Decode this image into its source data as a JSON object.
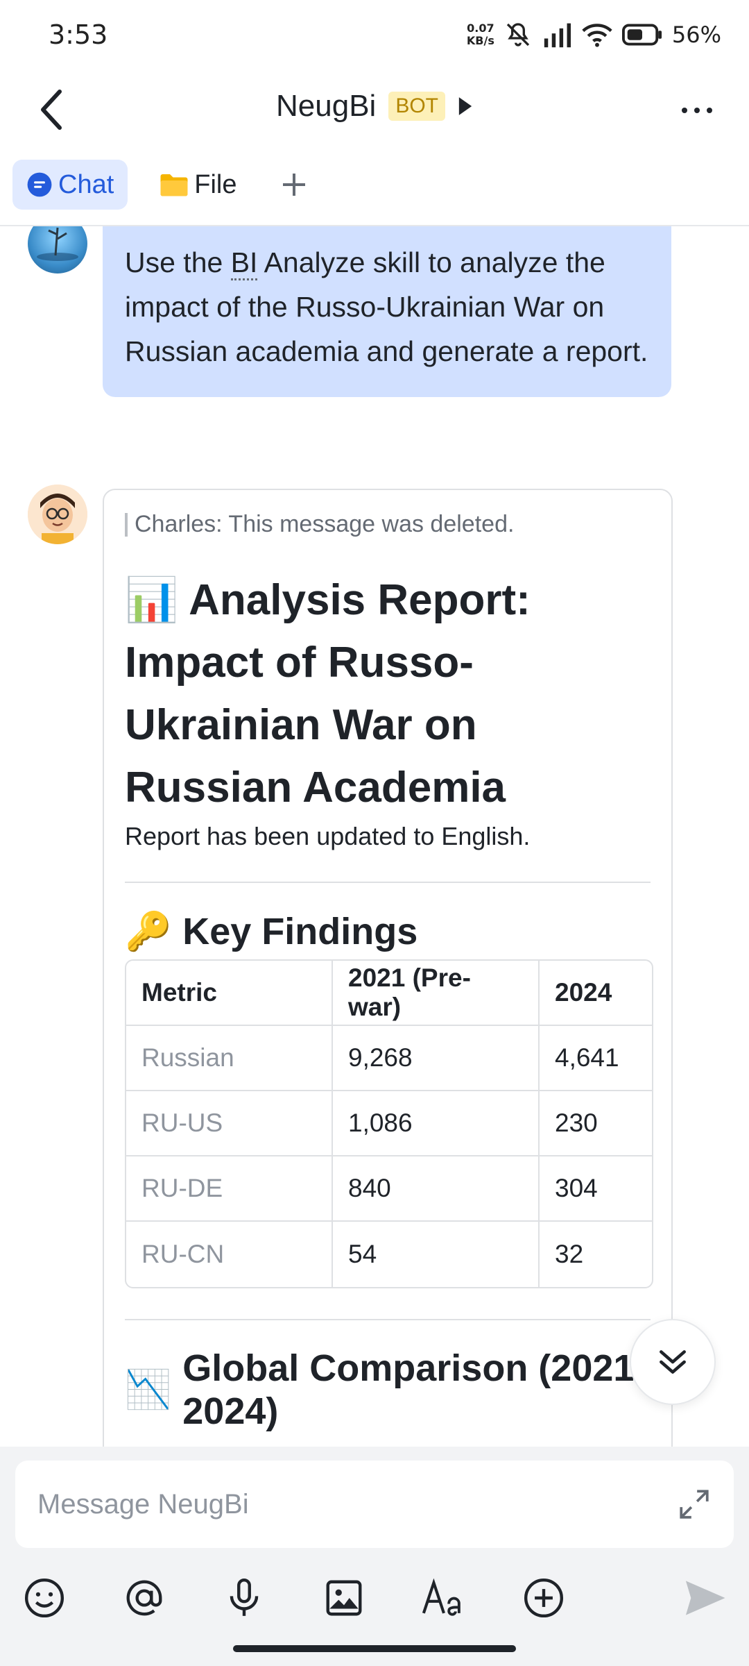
{
  "status_bar": {
    "time": "3:53",
    "net_speed_value": "0.07",
    "net_speed_unit": "KB/s",
    "battery": "56%"
  },
  "header": {
    "title": "NeugBi",
    "badge": "BOT"
  },
  "tabs": [
    {
      "label": "Chat",
      "icon": "chat-bubble-icon",
      "active": true
    },
    {
      "label": "File",
      "icon": "folder-icon",
      "active": false
    }
  ],
  "messages": {
    "user": {
      "text_before": "Use the ",
      "text_bi": "BI",
      "text_after": " Analyze skill to analyze the impact of the Russo-Ukrainian War on Russian academia and generate a report."
    },
    "bot": {
      "deleted_notice": "Charles: This message was deleted.",
      "report_icon": "📊",
      "report_title": "Analysis Report: Impact of Russo-Ukrainian War on Russian Academia",
      "report_subtitle": "Report has been updated to English.",
      "key_findings_icon": "🔑",
      "key_findings_title": "Key Findings",
      "table": {
        "headers": [
          "Metric",
          "2021 (Pre-war)",
          "2024"
        ],
        "rows": [
          [
            "Russian",
            "9,268",
            "4,641"
          ],
          [
            "RU-US",
            "1,086",
            "230"
          ],
          [
            "RU-DE",
            "840",
            "304"
          ],
          [
            "RU-CN",
            "54",
            "32"
          ]
        ]
      },
      "global_icon": "📉",
      "global_title": "Global Comparison (2021-2024)"
    }
  },
  "composer": {
    "placeholder": "Message NeugBi"
  },
  "toolbar_icons": [
    "emoji-icon",
    "mention-icon",
    "microphone-icon",
    "image-icon",
    "text-format-icon",
    "plus-circle-icon",
    "send-icon"
  ]
}
